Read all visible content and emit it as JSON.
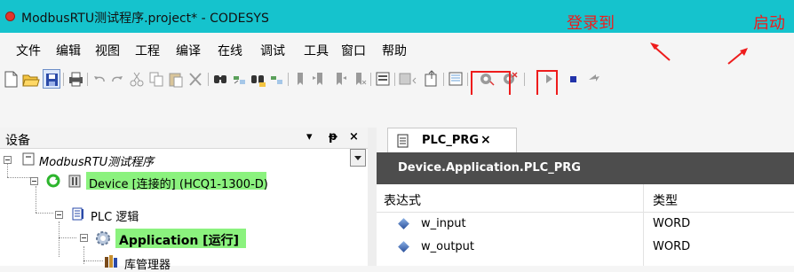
{
  "window": {
    "title": "ModbusRTU测试程序.project* - CODESYS"
  },
  "annotations": {
    "login": "登录到",
    "start": "启动"
  },
  "menu": [
    "文件",
    "编辑",
    "视图",
    "工程",
    "编译",
    "在线",
    "调试",
    "工具",
    "窗口",
    "帮助"
  ],
  "toolbar": {
    "icons": [
      "new-file-icon",
      "open-folder-icon",
      "save-icon",
      "print-icon",
      "undo-icon",
      "redo-icon",
      "cut-icon",
      "copy-icon",
      "paste-icon",
      "delete-icon",
      "find-icon",
      "replace-icon",
      "find-next-icon",
      "replace-next-icon",
      "bookmark-icon",
      "bookmark-next-icon",
      "bookmark-prev-icon",
      "bookmark-clear-icon",
      "properties-icon",
      "add-device-icon",
      "export-icon",
      "compile-icon",
      "login-icon",
      "logout-icon",
      "start-icon",
      "stop-icon",
      "reset-icon"
    ]
  },
  "devices_panel": {
    "title": "设备",
    "pin": "ᵽ",
    "close": "×",
    "tree": {
      "project": "ModbusRTU测试程序",
      "device": "Device [连接的] (HCQ1-1300-D)",
      "plc_logic": "PLC 逻辑",
      "application": "Application [运行]",
      "library_manager": "库管理器"
    }
  },
  "editor": {
    "tab_label": "PLC_PRG",
    "tab_close": "×",
    "header": "Device.Application.PLC_PRG",
    "columns": [
      "表达式",
      "类型"
    ],
    "rows": [
      {
        "expression": "w_input",
        "type": "WORD"
      },
      {
        "expression": "w_output",
        "type": "WORD"
      }
    ]
  },
  "colors": {
    "titlebar": "#15c3cd",
    "annotation": "#ee1c1c",
    "running_highlight": "#8bf27e",
    "editor_header": "#4d4d4d"
  }
}
